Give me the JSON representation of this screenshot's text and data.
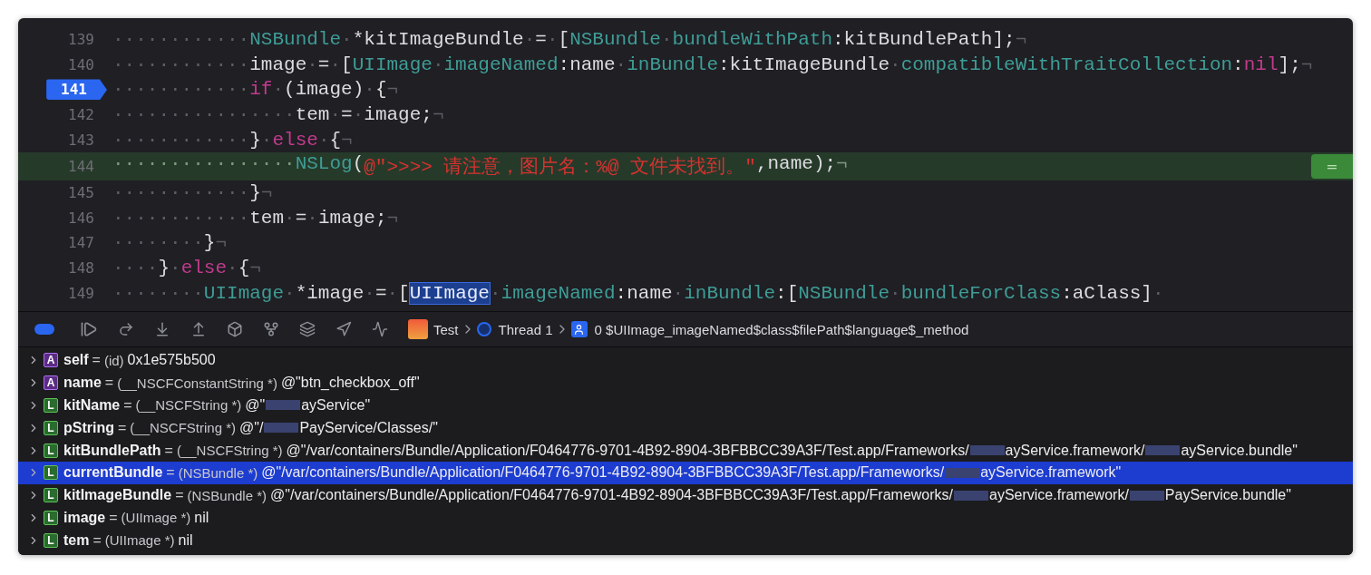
{
  "editor": {
    "lines": [
      {
        "number": "139",
        "breakpoint": false,
        "current": false,
        "tokens": [
          {
            "kind": "ws",
            "text": "············"
          },
          {
            "kind": "type",
            "text": "NSBundle"
          },
          {
            "kind": "ws",
            "text": "·"
          },
          {
            "kind": "plain",
            "text": "*kitImageBundle"
          },
          {
            "kind": "ws",
            "text": "·"
          },
          {
            "kind": "plain",
            "text": "="
          },
          {
            "kind": "ws",
            "text": "·"
          },
          {
            "kind": "plain",
            "text": "["
          },
          {
            "kind": "type",
            "text": "NSBundle"
          },
          {
            "kind": "ws",
            "text": "·"
          },
          {
            "kind": "type",
            "text": "bundleWithPath"
          },
          {
            "kind": "plain",
            "text": ":kitBundlePath];"
          },
          {
            "kind": "eol",
            "text": "¬"
          }
        ]
      },
      {
        "number": "140",
        "breakpoint": false,
        "current": false,
        "tokens": [
          {
            "kind": "ws",
            "text": "············"
          },
          {
            "kind": "plain",
            "text": "image"
          },
          {
            "kind": "ws",
            "text": "·"
          },
          {
            "kind": "plain",
            "text": "="
          },
          {
            "kind": "ws",
            "text": "·"
          },
          {
            "kind": "plain",
            "text": "["
          },
          {
            "kind": "type",
            "text": "UIImage"
          },
          {
            "kind": "ws",
            "text": "·"
          },
          {
            "kind": "type",
            "text": "imageNamed"
          },
          {
            "kind": "plain",
            "text": ":name"
          },
          {
            "kind": "ws",
            "text": "·"
          },
          {
            "kind": "type",
            "text": "inBundle"
          },
          {
            "kind": "plain",
            "text": ":kitImageBundle"
          },
          {
            "kind": "ws",
            "text": "·"
          },
          {
            "kind": "type",
            "text": "compatibleWithTraitCollection"
          },
          {
            "kind": "plain",
            "text": ":"
          },
          {
            "kind": "keyword",
            "text": "nil"
          },
          {
            "kind": "plain",
            "text": "];"
          },
          {
            "kind": "eol",
            "text": "¬"
          }
        ]
      },
      {
        "number": "141",
        "breakpoint": true,
        "current": false,
        "tokens": [
          {
            "kind": "ws",
            "text": "············"
          },
          {
            "kind": "keyword",
            "text": "if"
          },
          {
            "kind": "ws",
            "text": "·"
          },
          {
            "kind": "plain",
            "text": "(image)"
          },
          {
            "kind": "ws",
            "text": "·"
          },
          {
            "kind": "plain",
            "text": "{"
          },
          {
            "kind": "eol",
            "text": "¬"
          }
        ]
      },
      {
        "number": "142",
        "breakpoint": false,
        "current": false,
        "tokens": [
          {
            "kind": "ws",
            "text": "················"
          },
          {
            "kind": "plain",
            "text": "tem"
          },
          {
            "kind": "ws",
            "text": "·"
          },
          {
            "kind": "plain",
            "text": "="
          },
          {
            "kind": "ws",
            "text": "·"
          },
          {
            "kind": "plain",
            "text": "image;"
          },
          {
            "kind": "eol",
            "text": "¬"
          }
        ]
      },
      {
        "number": "143",
        "breakpoint": false,
        "current": false,
        "tokens": [
          {
            "kind": "ws",
            "text": "············"
          },
          {
            "kind": "plain",
            "text": "}"
          },
          {
            "kind": "ws",
            "text": "·"
          },
          {
            "kind": "keyword",
            "text": "else"
          },
          {
            "kind": "ws",
            "text": "·"
          },
          {
            "kind": "plain",
            "text": "{"
          },
          {
            "kind": "eol",
            "text": "¬"
          }
        ]
      },
      {
        "number": "144",
        "breakpoint": false,
        "current": true,
        "badge": "=",
        "tokens": [
          {
            "kind": "ws",
            "text": "················"
          },
          {
            "kind": "type",
            "text": "NSLog"
          },
          {
            "kind": "plain",
            "text": "("
          },
          {
            "kind": "string",
            "text": "@\">>>> 请注意，图片名：%@ 文件未找到。\""
          },
          {
            "kind": "plain",
            "text": ",name);"
          },
          {
            "kind": "eol",
            "text": "¬"
          }
        ]
      },
      {
        "number": "145",
        "breakpoint": false,
        "current": false,
        "tokens": [
          {
            "kind": "ws",
            "text": "············"
          },
          {
            "kind": "plain",
            "text": "}"
          },
          {
            "kind": "eol",
            "text": "¬"
          }
        ]
      },
      {
        "number": "146",
        "breakpoint": false,
        "current": false,
        "tokens": [
          {
            "kind": "ws",
            "text": "············"
          },
          {
            "kind": "plain",
            "text": "tem"
          },
          {
            "kind": "ws",
            "text": "·"
          },
          {
            "kind": "plain",
            "text": "="
          },
          {
            "kind": "ws",
            "text": "·"
          },
          {
            "kind": "plain",
            "text": "image;"
          },
          {
            "kind": "eol",
            "text": "¬"
          }
        ]
      },
      {
        "number": "147",
        "breakpoint": false,
        "current": false,
        "tokens": [
          {
            "kind": "ws",
            "text": "········"
          },
          {
            "kind": "plain",
            "text": "}"
          },
          {
            "kind": "eol",
            "text": "¬"
          }
        ]
      },
      {
        "number": "148",
        "breakpoint": false,
        "current": false,
        "tokens": [
          {
            "kind": "ws",
            "text": "····"
          },
          {
            "kind": "plain",
            "text": "}"
          },
          {
            "kind": "ws",
            "text": "·"
          },
          {
            "kind": "keyword",
            "text": "else"
          },
          {
            "kind": "ws",
            "text": "·"
          },
          {
            "kind": "plain",
            "text": "{"
          },
          {
            "kind": "eol",
            "text": "¬"
          }
        ]
      },
      {
        "number": "149",
        "breakpoint": false,
        "current": false,
        "tokens": [
          {
            "kind": "ws",
            "text": "········"
          },
          {
            "kind": "type",
            "text": "UIImage"
          },
          {
            "kind": "ws",
            "text": "·"
          },
          {
            "kind": "plain",
            "text": "*image"
          },
          {
            "kind": "ws",
            "text": "·"
          },
          {
            "kind": "plain",
            "text": "="
          },
          {
            "kind": "ws",
            "text": "·"
          },
          {
            "kind": "plain",
            "text": "["
          },
          {
            "kind": "selection",
            "text": "UIImage"
          },
          {
            "kind": "ws",
            "text": "·"
          },
          {
            "kind": "type",
            "text": "imageNamed"
          },
          {
            "kind": "plain",
            "text": ":name"
          },
          {
            "kind": "ws",
            "text": "·"
          },
          {
            "kind": "type",
            "text": "inBundle"
          },
          {
            "kind": "plain",
            "text": ":["
          },
          {
            "kind": "type",
            "text": "NSBundle"
          },
          {
            "kind": "ws",
            "text": "·"
          },
          {
            "kind": "type",
            "text": "bundleForClass"
          },
          {
            "kind": "plain",
            "text": ":aClass]"
          },
          {
            "kind": "eol",
            "text": "·"
          }
        ]
      }
    ]
  },
  "debug_bar": {
    "breadcrumbs": [
      {
        "kind": "app",
        "label": "Test"
      },
      {
        "kind": "thread",
        "label": "Thread 1"
      },
      {
        "kind": "frame",
        "label": "0 $UIImage_imageNamed$class$filePath$language$_method"
      }
    ]
  },
  "variables": [
    {
      "kind": "argument",
      "badge": "A",
      "name": "self",
      "equals": "=",
      "type": "(id)",
      "value_parts": [
        "0x1e575b500"
      ],
      "selected": false
    },
    {
      "kind": "argument",
      "badge": "A",
      "name": "name",
      "equals": "=",
      "type": "(__NSCFConstantString *)",
      "value_parts": [
        "@\"btn_checkbox_off\""
      ],
      "selected": false
    },
    {
      "kind": "local",
      "badge": "L",
      "name": "kitName",
      "equals": "=",
      "type": "(__NSCFString *)",
      "value_parts": [
        "@\"",
        "ayService\""
      ],
      "selected": false
    },
    {
      "kind": "local",
      "badge": "L",
      "name": "pString",
      "equals": "=",
      "type": "(__NSCFString *)",
      "value_parts": [
        "@\"/",
        "PayService/Classes/\""
      ],
      "selected": false
    },
    {
      "kind": "local",
      "badge": "L",
      "name": "kitBundlePath",
      "equals": "=",
      "type": "(__NSCFString *)",
      "value_parts": [
        "@\"/var/containers/Bundle/Application/F0464776-9701-4B92-8904-3BFBBCC39A3F/Test.app/Frameworks/",
        "ayService.framework/",
        "ayService.bundle\""
      ],
      "selected": false
    },
    {
      "kind": "local",
      "badge": "L",
      "name": "currentBundle",
      "equals": "=",
      "type": "(NSBundle *)",
      "value_parts": [
        "@\"/var/containers/Bundle/Application/F0464776-9701-4B92-8904-3BFBBCC39A3F/Test.app/Frameworks/",
        "ayService.framework\""
      ],
      "selected": true
    },
    {
      "kind": "local",
      "badge": "L",
      "name": "kitImageBundle",
      "equals": "=",
      "type": "(NSBundle *)",
      "value_parts": [
        "@\"/var/containers/Bundle/Application/F0464776-9701-4B92-8904-3BFBBCC39A3F/Test.app/Frameworks/",
        "ayService.framework/",
        "PayService.bundle\""
      ],
      "selected": false
    },
    {
      "kind": "local",
      "badge": "L",
      "name": "image",
      "equals": "=",
      "type": "(UIImage *)",
      "value_parts": [
        "nil"
      ],
      "selected": false
    },
    {
      "kind": "local",
      "badge": "L",
      "name": "tem",
      "equals": "=",
      "type": "(UIImage *)",
      "value_parts": [
        "nil"
      ],
      "selected": false
    }
  ]
}
